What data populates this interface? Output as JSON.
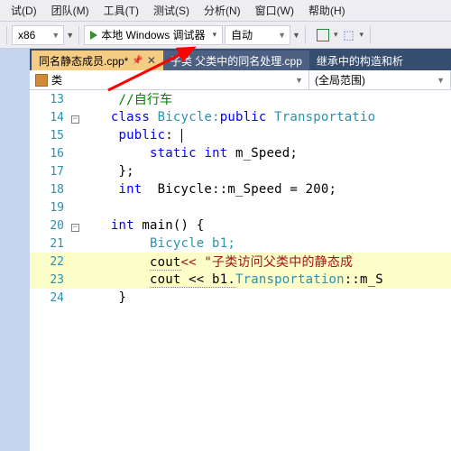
{
  "menu": {
    "items": [
      "试(D)",
      "团队(M)",
      "工具(T)",
      "测试(S)",
      "分析(N)",
      "窗口(W)",
      "帮助(H)"
    ]
  },
  "toolbar": {
    "platform": "x86",
    "debug_label": "本地 Windows 调试器",
    "debug_mode": "自动"
  },
  "tabs": {
    "active": {
      "label": "同名静态成员.cpp*"
    },
    "second": {
      "label": "子类    父类中的同名处理.cpp"
    },
    "third": {
      "label": "继承中的构造和析"
    }
  },
  "navbar": {
    "scope": "类",
    "right": "(全局范围)"
  },
  "code": {
    "l13": "//自行车",
    "l14a": "class",
    "l14b": " Bicycle:",
    "l14c": "public",
    "l14d": " Transportatio",
    "l15a": "public",
    "l15b": ": ",
    "l16a": "static",
    "l16b": " int",
    "l16c": " m_Speed;",
    "l17": "};",
    "l18a": "int",
    "l18b": "  Bicycle::m_Speed = 200;",
    "l20a": "int",
    "l20b": " main() {",
    "l21": "Bicycle b1;",
    "l22a": "cout",
    "l22b": "<< \"子类访问父类中的静态成",
    "l23a": "cout << b1.",
    "l23b": "Transportation",
    "l23c": "::m_S"
  },
  "lines": {
    "13": "13",
    "14": "14",
    "15": "15",
    "16": "16",
    "17": "17",
    "18": "18",
    "19": "19",
    "20": "20",
    "21": "21",
    "22": "22",
    "23": "23",
    "24": "24"
  }
}
